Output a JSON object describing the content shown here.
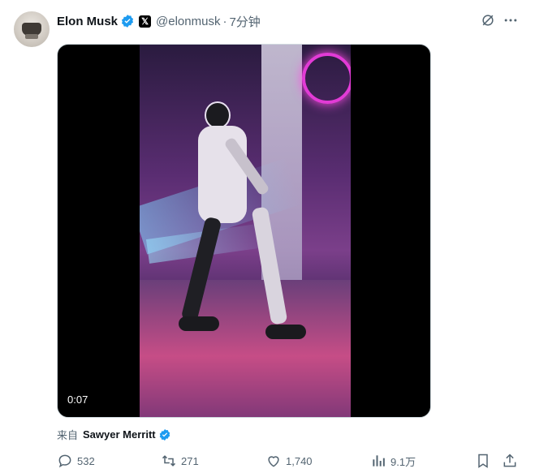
{
  "tweet": {
    "author_name": "Elon Musk",
    "handle": "@elonmusk",
    "separator": "·",
    "time": "7分钟",
    "x_badge": "𝕏"
  },
  "media": {
    "duration": "0:07"
  },
  "source": {
    "prefix": "来自",
    "author": "Sawyer Merritt"
  },
  "actions": {
    "replies": "532",
    "reposts": "271",
    "likes": "1,740",
    "views": "9.1万"
  },
  "icons": {
    "verified": "verified-badge-icon",
    "grok": "grok-icon",
    "more": "more-icon",
    "reply": "reply-icon",
    "repost": "repost-icon",
    "like": "like-icon",
    "views": "views-icon",
    "bookmark": "bookmark-icon",
    "share": "share-icon"
  },
  "colors": {
    "accent": "#1d9bf0",
    "text": "#0f1419",
    "secondary": "#536471"
  }
}
